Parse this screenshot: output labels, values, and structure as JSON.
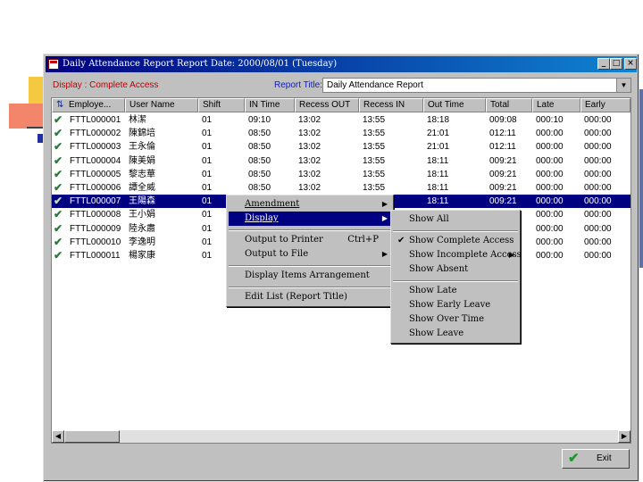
{
  "window": {
    "title": "Daily Attendance Report   Report Date: 2000/08/01 (Tuesday)",
    "minimize": "_",
    "maximize": "□",
    "close": "×"
  },
  "toolbar": {
    "display_label": "Display : Complete Access",
    "report_title_label": "Report Title:",
    "report_title_value": "Daily Attendance Report"
  },
  "table": {
    "columns": [
      "Employe...",
      "User Name",
      "Shift",
      "IN Time",
      "Recess OUT",
      "Recess IN",
      "Out Time",
      "Total",
      "Late",
      "Early"
    ],
    "rows": [
      {
        "emp": "FTTL000001",
        "name": "林潔",
        "shift": "01",
        "in": "09:10",
        "rout": "13:02",
        "rin": "13:55",
        "out": "18:18",
        "total": "009:08",
        "late": "000:10",
        "early": "000:00"
      },
      {
        "emp": "FTTL000002",
        "name": "陳錦培",
        "shift": "01",
        "in": "08:50",
        "rout": "13:02",
        "rin": "13:55",
        "out": "21:01",
        "total": "012:11",
        "late": "000:00",
        "early": "000:00"
      },
      {
        "emp": "FTTL000003",
        "name": "王永倫",
        "shift": "01",
        "in": "08:50",
        "rout": "13:02",
        "rin": "13:55",
        "out": "21:01",
        "total": "012:11",
        "late": "000:00",
        "early": "000:00"
      },
      {
        "emp": "FTTL000004",
        "name": "陳美娟",
        "shift": "01",
        "in": "08:50",
        "rout": "13:02",
        "rin": "13:55",
        "out": "18:11",
        "total": "009:21",
        "late": "000:00",
        "early": "000:00"
      },
      {
        "emp": "FTTL000005",
        "name": "黎志華",
        "shift": "01",
        "in": "08:50",
        "rout": "13:02",
        "rin": "13:55",
        "out": "18:11",
        "total": "009:21",
        "late": "000:00",
        "early": "000:00"
      },
      {
        "emp": "FTTL000006",
        "name": "譚全威",
        "shift": "01",
        "in": "08:50",
        "rout": "13:02",
        "rin": "13:55",
        "out": "18:11",
        "total": "009:21",
        "late": "000:00",
        "early": "000:00"
      },
      {
        "emp": "FTTL000007",
        "name": "王陽森",
        "shift": "01",
        "in": "",
        "rout": "",
        "rin": "",
        "out": "18:11",
        "total": "009:21",
        "late": "000:00",
        "early": "000:00"
      },
      {
        "emp": "FTTL000008",
        "name": "王小娟",
        "shift": "01",
        "in": "",
        "rout": "",
        "rin": "",
        "out": "",
        "total": "",
        "late": "000:00",
        "early": "000:00"
      },
      {
        "emp": "FTTL000009",
        "name": "陸永肅",
        "shift": "01",
        "in": "",
        "rout": "",
        "rin": "",
        "out": "",
        "total": "",
        "late": "000:00",
        "early": "000:00"
      },
      {
        "emp": "FTTL000010",
        "name": "李逸明",
        "shift": "01",
        "in": "",
        "rout": "",
        "rin": "",
        "out": "",
        "total": "",
        "late": "000:00",
        "early": "000:00"
      },
      {
        "emp": "FTTL000011",
        "name": "楊家康",
        "shift": "01",
        "in": "",
        "rout": "",
        "rin": "",
        "out": "",
        "total": "",
        "late": "000:00",
        "early": "000:00"
      }
    ]
  },
  "context_menu": {
    "amendment": "Amendment",
    "display": "Display",
    "output_printer": "Output to Printer",
    "output_printer_shortcut": "Ctrl+P",
    "output_file": "Output to File",
    "display_items": "Display Items Arrangement",
    "edit_list": "Edit List (Report Title)"
  },
  "submenu": {
    "show_all": "Show All",
    "show_complete": "Show Complete Access",
    "show_incomplete": "Show Incomplete Access",
    "show_absent": "Show Absent",
    "show_late": "Show Late",
    "show_early": "Show Early Leave",
    "show_overtime": "Show Over Time",
    "show_leave": "Show Leave"
  },
  "footer": {
    "exit": "Exit"
  }
}
